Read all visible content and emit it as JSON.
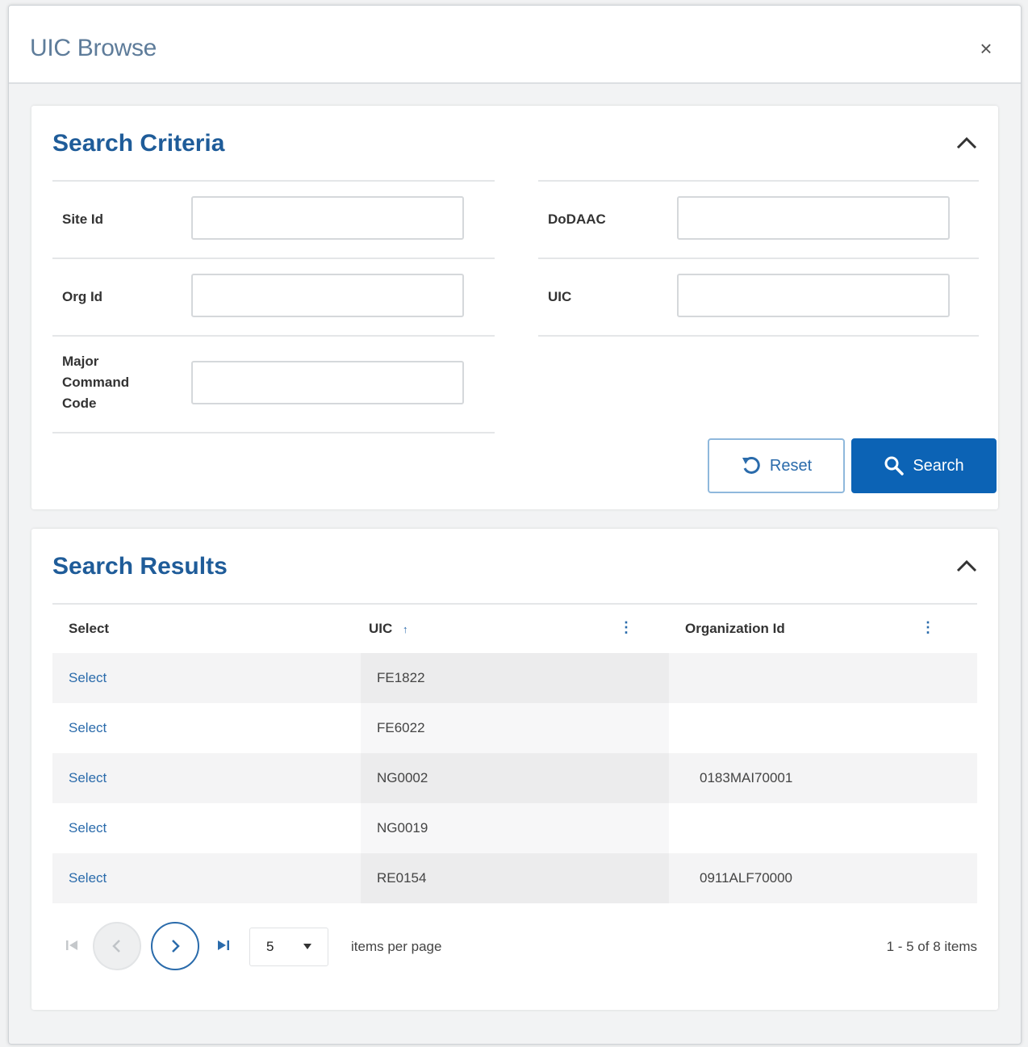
{
  "dialog": {
    "title": "UIC Browse",
    "close_label": "×"
  },
  "search_criteria": {
    "title": "Search Criteria",
    "fields": {
      "site_id": {
        "label": "Site Id",
        "value": ""
      },
      "dodaac": {
        "label": "DoDAAC",
        "value": ""
      },
      "org_id": {
        "label": "Org Id",
        "value": ""
      },
      "uic": {
        "label": "UIC",
        "value": ""
      },
      "major_command_code": {
        "label_lines": [
          "Major",
          "Command",
          "Code"
        ],
        "value": ""
      }
    },
    "reset_label": "Reset",
    "search_label": "Search"
  },
  "search_results": {
    "title": "Search Results",
    "columns": {
      "select": "Select",
      "uic": "UIC",
      "uic_sort": "↑",
      "org": "Organization Id",
      "menu_glyph": "⋮"
    },
    "rows": [
      {
        "select": "Select",
        "uic": "FE1822",
        "org": ""
      },
      {
        "select": "Select",
        "uic": "FE6022",
        "org": ""
      },
      {
        "select": "Select",
        "uic": "NG0002",
        "org": "0183MAI70001"
      },
      {
        "select": "Select",
        "uic": "NG0019",
        "org": ""
      },
      {
        "select": "Select",
        "uic": "RE0154",
        "org": "0911ALF70000"
      }
    ],
    "pager": {
      "page_size": "5",
      "items_per_page_label": "items per page",
      "summary": "1 - 5 of 8 items"
    }
  },
  "colors": {
    "accent": "#0c63b5",
    "title": "#1f5c99",
    "link": "#2a6bab"
  }
}
